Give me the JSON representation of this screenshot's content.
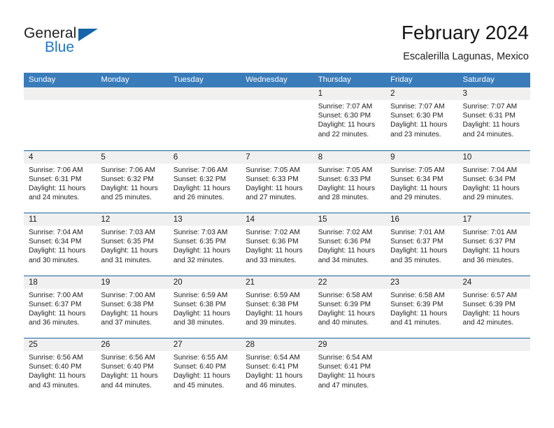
{
  "brand": {
    "name_top": "General",
    "name_bottom": "Blue",
    "accent_color": "#2077c0",
    "triangle_color": "#1565a8"
  },
  "header": {
    "title": "February 2024",
    "subtitle": "Escalerilla Lagunas, Mexico"
  },
  "theme": {
    "header_row_bg": "#3a7cba",
    "row_divider": "#19639e",
    "day_number_bg": "#f0f0f0"
  },
  "weekdays": [
    "Sunday",
    "Monday",
    "Tuesday",
    "Wednesday",
    "Thursday",
    "Friday",
    "Saturday"
  ],
  "weeks": [
    [
      {
        "day": "",
        "sunrise": "",
        "sunset": "",
        "daylight_line1": "",
        "daylight_line2": ""
      },
      {
        "day": "",
        "sunrise": "",
        "sunset": "",
        "daylight_line1": "",
        "daylight_line2": ""
      },
      {
        "day": "",
        "sunrise": "",
        "sunset": "",
        "daylight_line1": "",
        "daylight_line2": ""
      },
      {
        "day": "",
        "sunrise": "",
        "sunset": "",
        "daylight_line1": "",
        "daylight_line2": ""
      },
      {
        "day": "1",
        "sunrise": "Sunrise: 7:07 AM",
        "sunset": "Sunset: 6:30 PM",
        "daylight_line1": "Daylight: 11 hours",
        "daylight_line2": "and 22 minutes."
      },
      {
        "day": "2",
        "sunrise": "Sunrise: 7:07 AM",
        "sunset": "Sunset: 6:30 PM",
        "daylight_line1": "Daylight: 11 hours",
        "daylight_line2": "and 23 minutes."
      },
      {
        "day": "3",
        "sunrise": "Sunrise: 7:07 AM",
        "sunset": "Sunset: 6:31 PM",
        "daylight_line1": "Daylight: 11 hours",
        "daylight_line2": "and 24 minutes."
      }
    ],
    [
      {
        "day": "4",
        "sunrise": "Sunrise: 7:06 AM",
        "sunset": "Sunset: 6:31 PM",
        "daylight_line1": "Daylight: 11 hours",
        "daylight_line2": "and 24 minutes."
      },
      {
        "day": "5",
        "sunrise": "Sunrise: 7:06 AM",
        "sunset": "Sunset: 6:32 PM",
        "daylight_line1": "Daylight: 11 hours",
        "daylight_line2": "and 25 minutes."
      },
      {
        "day": "6",
        "sunrise": "Sunrise: 7:06 AM",
        "sunset": "Sunset: 6:32 PM",
        "daylight_line1": "Daylight: 11 hours",
        "daylight_line2": "and 26 minutes."
      },
      {
        "day": "7",
        "sunrise": "Sunrise: 7:05 AM",
        "sunset": "Sunset: 6:33 PM",
        "daylight_line1": "Daylight: 11 hours",
        "daylight_line2": "and 27 minutes."
      },
      {
        "day": "8",
        "sunrise": "Sunrise: 7:05 AM",
        "sunset": "Sunset: 6:33 PM",
        "daylight_line1": "Daylight: 11 hours",
        "daylight_line2": "and 28 minutes."
      },
      {
        "day": "9",
        "sunrise": "Sunrise: 7:05 AM",
        "sunset": "Sunset: 6:34 PM",
        "daylight_line1": "Daylight: 11 hours",
        "daylight_line2": "and 29 minutes."
      },
      {
        "day": "10",
        "sunrise": "Sunrise: 7:04 AM",
        "sunset": "Sunset: 6:34 PM",
        "daylight_line1": "Daylight: 11 hours",
        "daylight_line2": "and 29 minutes."
      }
    ],
    [
      {
        "day": "11",
        "sunrise": "Sunrise: 7:04 AM",
        "sunset": "Sunset: 6:34 PM",
        "daylight_line1": "Daylight: 11 hours",
        "daylight_line2": "and 30 minutes."
      },
      {
        "day": "12",
        "sunrise": "Sunrise: 7:03 AM",
        "sunset": "Sunset: 6:35 PM",
        "daylight_line1": "Daylight: 11 hours",
        "daylight_line2": "and 31 minutes."
      },
      {
        "day": "13",
        "sunrise": "Sunrise: 7:03 AM",
        "sunset": "Sunset: 6:35 PM",
        "daylight_line1": "Daylight: 11 hours",
        "daylight_line2": "and 32 minutes."
      },
      {
        "day": "14",
        "sunrise": "Sunrise: 7:02 AM",
        "sunset": "Sunset: 6:36 PM",
        "daylight_line1": "Daylight: 11 hours",
        "daylight_line2": "and 33 minutes."
      },
      {
        "day": "15",
        "sunrise": "Sunrise: 7:02 AM",
        "sunset": "Sunset: 6:36 PM",
        "daylight_line1": "Daylight: 11 hours",
        "daylight_line2": "and 34 minutes."
      },
      {
        "day": "16",
        "sunrise": "Sunrise: 7:01 AM",
        "sunset": "Sunset: 6:37 PM",
        "daylight_line1": "Daylight: 11 hours",
        "daylight_line2": "and 35 minutes."
      },
      {
        "day": "17",
        "sunrise": "Sunrise: 7:01 AM",
        "sunset": "Sunset: 6:37 PM",
        "daylight_line1": "Daylight: 11 hours",
        "daylight_line2": "and 36 minutes."
      }
    ],
    [
      {
        "day": "18",
        "sunrise": "Sunrise: 7:00 AM",
        "sunset": "Sunset: 6:37 PM",
        "daylight_line1": "Daylight: 11 hours",
        "daylight_line2": "and 36 minutes."
      },
      {
        "day": "19",
        "sunrise": "Sunrise: 7:00 AM",
        "sunset": "Sunset: 6:38 PM",
        "daylight_line1": "Daylight: 11 hours",
        "daylight_line2": "and 37 minutes."
      },
      {
        "day": "20",
        "sunrise": "Sunrise: 6:59 AM",
        "sunset": "Sunset: 6:38 PM",
        "daylight_line1": "Daylight: 11 hours",
        "daylight_line2": "and 38 minutes."
      },
      {
        "day": "21",
        "sunrise": "Sunrise: 6:59 AM",
        "sunset": "Sunset: 6:38 PM",
        "daylight_line1": "Daylight: 11 hours",
        "daylight_line2": "and 39 minutes."
      },
      {
        "day": "22",
        "sunrise": "Sunrise: 6:58 AM",
        "sunset": "Sunset: 6:39 PM",
        "daylight_line1": "Daylight: 11 hours",
        "daylight_line2": "and 40 minutes."
      },
      {
        "day": "23",
        "sunrise": "Sunrise: 6:58 AM",
        "sunset": "Sunset: 6:39 PM",
        "daylight_line1": "Daylight: 11 hours",
        "daylight_line2": "and 41 minutes."
      },
      {
        "day": "24",
        "sunrise": "Sunrise: 6:57 AM",
        "sunset": "Sunset: 6:39 PM",
        "daylight_line1": "Daylight: 11 hours",
        "daylight_line2": "and 42 minutes."
      }
    ],
    [
      {
        "day": "25",
        "sunrise": "Sunrise: 6:56 AM",
        "sunset": "Sunset: 6:40 PM",
        "daylight_line1": "Daylight: 11 hours",
        "daylight_line2": "and 43 minutes."
      },
      {
        "day": "26",
        "sunrise": "Sunrise: 6:56 AM",
        "sunset": "Sunset: 6:40 PM",
        "daylight_line1": "Daylight: 11 hours",
        "daylight_line2": "and 44 minutes."
      },
      {
        "day": "27",
        "sunrise": "Sunrise: 6:55 AM",
        "sunset": "Sunset: 6:40 PM",
        "daylight_line1": "Daylight: 11 hours",
        "daylight_line2": "and 45 minutes."
      },
      {
        "day": "28",
        "sunrise": "Sunrise: 6:54 AM",
        "sunset": "Sunset: 6:41 PM",
        "daylight_line1": "Daylight: 11 hours",
        "daylight_line2": "and 46 minutes."
      },
      {
        "day": "29",
        "sunrise": "Sunrise: 6:54 AM",
        "sunset": "Sunset: 6:41 PM",
        "daylight_line1": "Daylight: 11 hours",
        "daylight_line2": "and 47 minutes."
      },
      {
        "day": "",
        "sunrise": "",
        "sunset": "",
        "daylight_line1": "",
        "daylight_line2": ""
      },
      {
        "day": "",
        "sunrise": "",
        "sunset": "",
        "daylight_line1": "",
        "daylight_line2": ""
      }
    ]
  ]
}
